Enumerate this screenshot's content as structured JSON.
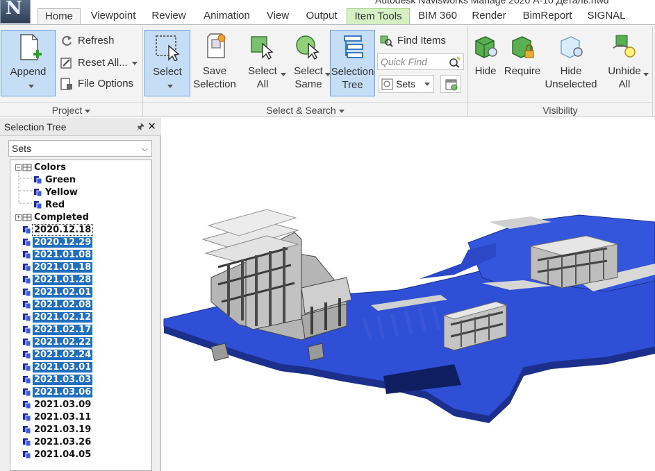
{
  "app": {
    "title": "Autodesk Navisworks Manage 2020   А-10 Деталь.nwd",
    "logo_letter": "N"
  },
  "tabs": [
    {
      "label": "Home",
      "state": "active"
    },
    {
      "label": "Viewpoint"
    },
    {
      "label": "Review"
    },
    {
      "label": "Animation"
    },
    {
      "label": "View"
    },
    {
      "label": "Output"
    },
    {
      "label": "Item Tools",
      "state": "contextual"
    },
    {
      "label": "BIM 360"
    },
    {
      "label": "Render"
    },
    {
      "label": "BimReport"
    },
    {
      "label": "SIGNAL"
    }
  ],
  "ribbon": {
    "project": {
      "title": "Project",
      "append_label": "Append",
      "refresh_label": "Refresh",
      "reset_all_label": "Reset All...",
      "file_options_label": "File Options"
    },
    "select_search": {
      "title": "Select & Search",
      "select_label": "Select",
      "save_selection_line1": "Save",
      "save_selection_line2": "Selection",
      "select_all_line1": "Select",
      "select_all_line2": "All",
      "select_same_line1": "Select",
      "select_same_line2": "Same",
      "selection_tree_line1": "Selection",
      "selection_tree_line2": "Tree",
      "find_items_label": "Find Items",
      "quick_find_placeholder": "Quick Find",
      "sets_label": "Sets"
    },
    "visibility": {
      "title": "Visibility",
      "hide_label": "Hide",
      "require_label": "Require",
      "hide_unselected_line1": "Hide",
      "hide_unselected_line2": "Unselected",
      "unhide_all_line1": "Unhide",
      "unhide_all_line2": "All"
    }
  },
  "selection_tree": {
    "title": "Selection Tree",
    "dropdown_value": "Sets",
    "groups": [
      {
        "label": "Colors",
        "expanded": true,
        "items": [
          {
            "label": "Green"
          },
          {
            "label": "Yellow"
          },
          {
            "label": "Red"
          }
        ]
      },
      {
        "label": "Completed",
        "expanded": false
      }
    ],
    "sets": [
      {
        "label": "2020.12.18",
        "selected": false,
        "focused": true
      },
      {
        "label": "2020.12.29",
        "selected": true
      },
      {
        "label": "2021.01.08",
        "selected": true
      },
      {
        "label": "2021.01.18",
        "selected": true
      },
      {
        "label": "2021.01.28",
        "selected": true
      },
      {
        "label": "2021.02.01",
        "selected": true
      },
      {
        "label": "2021.02.08",
        "selected": true
      },
      {
        "label": "2021.02.12",
        "selected": true
      },
      {
        "label": "2021.02.17",
        "selected": true
      },
      {
        "label": "2021.02.22",
        "selected": true
      },
      {
        "label": "2021.02.24",
        "selected": true
      },
      {
        "label": "2021.03.01",
        "selected": true
      },
      {
        "label": "2021.03.03",
        "selected": true
      },
      {
        "label": "2021.03.06",
        "selected": true
      },
      {
        "label": "2021.03.09",
        "selected": false
      },
      {
        "label": "2021.03.11",
        "selected": false
      },
      {
        "label": "2021.03.19",
        "selected": false
      },
      {
        "label": "2021.03.26",
        "selected": false
      },
      {
        "label": "2021.04.05",
        "selected": false
      }
    ]
  },
  "colors": {
    "selection_blue": "#1f6fc0",
    "model_highlight_blue": "#2f4fd6",
    "model_gray": "#c8c8c8",
    "contextual_tab_green": "#d6f0c4"
  }
}
